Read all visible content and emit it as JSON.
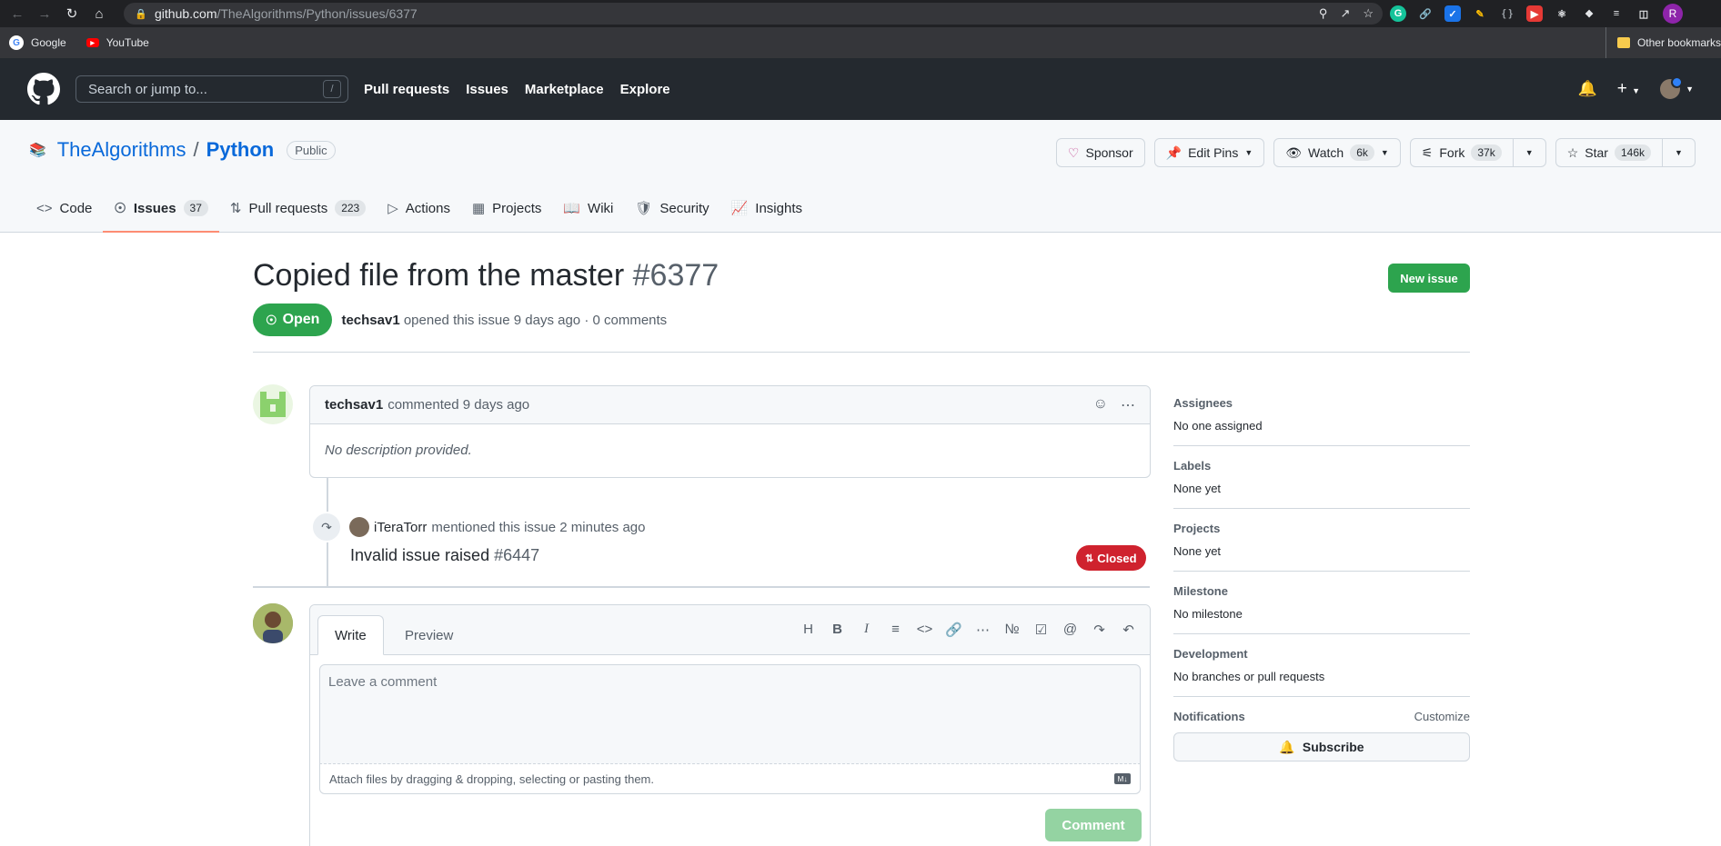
{
  "browser": {
    "url_host": "github.com",
    "url_path": "/TheAlgorithms/Python/issues/6377",
    "bookmarks": [
      {
        "label": "Google"
      },
      {
        "label": "YouTube"
      }
    ],
    "other_bookmarks": "Other bookmarks",
    "profile_initial": "R"
  },
  "header": {
    "search_placeholder": "Search or jump to...",
    "search_shortcut": "/",
    "nav": [
      "Pull requests",
      "Issues",
      "Marketplace",
      "Explore"
    ]
  },
  "repo": {
    "owner": "TheAlgorithms",
    "separator": "/",
    "name": "Python",
    "visibility": "Public",
    "sponsor_label": "Sponsor",
    "edit_pins_label": "Edit Pins",
    "watch_label": "Watch",
    "watch_count": "6k",
    "fork_label": "Fork",
    "fork_count": "37k",
    "star_label": "Star",
    "star_count": "146k",
    "tabs": [
      {
        "label": "Code",
        "count": ""
      },
      {
        "label": "Issues",
        "count": "37"
      },
      {
        "label": "Pull requests",
        "count": "223"
      },
      {
        "label": "Actions",
        "count": ""
      },
      {
        "label": "Projects",
        "count": ""
      },
      {
        "label": "Wiki",
        "count": ""
      },
      {
        "label": "Security",
        "count": ""
      },
      {
        "label": "Insights",
        "count": ""
      }
    ]
  },
  "issue": {
    "title": "Copied file from the master",
    "number": "#6377",
    "new_issue_label": "New issue",
    "state": "Open",
    "author": "techsav1",
    "meta_text": "opened this issue 9 days ago · 0 comments",
    "comment": {
      "author": "techsav1",
      "time": "commented 9 days ago",
      "body": "No description provided."
    },
    "mention": {
      "user": "iTeraTorr",
      "text": "mentioned this issue 2 minutes ago",
      "ref_title": "Invalid issue raised",
      "ref_number": "#6447",
      "ref_state": "Closed"
    }
  },
  "editor": {
    "tab_write": "Write",
    "tab_preview": "Preview",
    "placeholder": "Leave a comment",
    "attach_text": "Attach files by dragging & dropping, selecting or pasting them.",
    "submit_label": "Comment"
  },
  "sidebar": {
    "assignees_title": "Assignees",
    "assignees_value": "No one assigned",
    "labels_title": "Labels",
    "labels_value": "None yet",
    "projects_title": "Projects",
    "projects_value": "None yet",
    "milestone_title": "Milestone",
    "milestone_value": "No milestone",
    "development_title": "Development",
    "development_value": "No branches or pull requests",
    "notifications_title": "Notifications",
    "customize_label": "Customize",
    "subscribe_label": "Subscribe"
  },
  "colors": {
    "open_green": "#2da44e",
    "closed_red": "#cf222e",
    "link_blue": "#0969da",
    "header_dark": "#24292f"
  }
}
